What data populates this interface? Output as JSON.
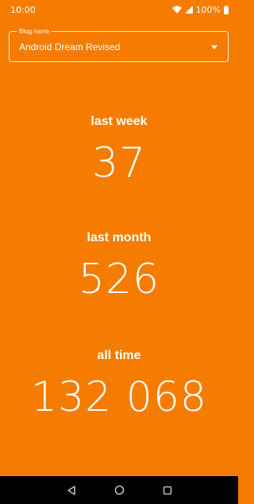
{
  "status_bar": {
    "time": "10:00",
    "battery": "100%",
    "icons": [
      "wifi-icon",
      "signal-icon",
      "battery-icon"
    ]
  },
  "blog_selector": {
    "label": "Blog name",
    "value": "Android Dream Revised"
  },
  "stats": {
    "last_week": {
      "label": "last week",
      "value": "37"
    },
    "last_month": {
      "label": "last month",
      "value": "526"
    },
    "all_time": {
      "label": "all time",
      "value": "132 068"
    }
  },
  "nav_bar": {
    "icons": [
      "back-icon",
      "home-icon",
      "recents-icon"
    ]
  },
  "colors": {
    "background": "#f57c00",
    "text": "#ffffff",
    "nav_bar": "#000000"
  }
}
